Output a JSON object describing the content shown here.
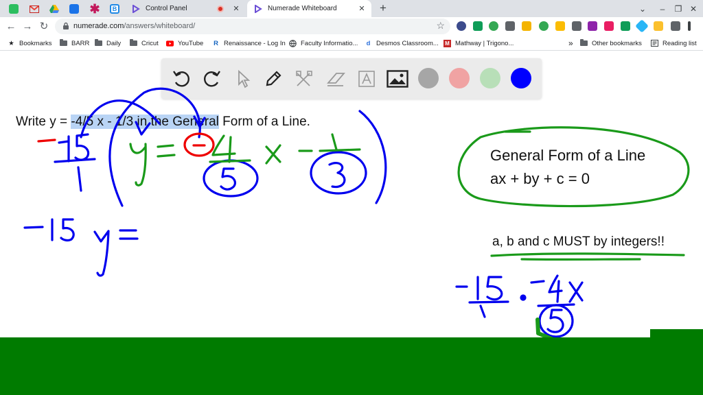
{
  "browser": {
    "pinned_tabs": [
      {
        "icon": "classroom-icon",
        "color": "#2dbe60"
      },
      {
        "icon": "gmail-icon",
        "color": "#ea4335"
      },
      {
        "icon": "drive-icon",
        "color": "#fbbc04"
      },
      {
        "icon": "contacts-icon",
        "color": "#1a73e8"
      },
      {
        "icon": "asterisk-icon",
        "color": "#c2185b"
      },
      {
        "icon": "b-icon",
        "color": "#1e88e5"
      }
    ],
    "tabs": [
      {
        "title": "Control Panel",
        "active": false,
        "icon": "numerade-icon"
      },
      {
        "title": "Numerade Whiteboard",
        "active": true,
        "icon": "numerade-icon"
      }
    ],
    "recording_indicator_color": "#d93025",
    "url_host": "numerade.com",
    "url_path": "/answers/whiteboard/",
    "bookmarks": [
      {
        "label": "Bookmarks",
        "icon": "star-icon"
      },
      {
        "label": "BARR",
        "icon": "folder-icon"
      },
      {
        "label": "Daily",
        "icon": "folder-icon"
      },
      {
        "label": "Cricut",
        "icon": "folder-icon"
      },
      {
        "label": "YouTube",
        "icon": "youtube-icon"
      },
      {
        "label": "Renaissance - Log In",
        "icon": "renaissance-icon"
      },
      {
        "label": "Faculty Informatio...",
        "icon": "globe-icon"
      },
      {
        "label": "Desmos Classroom...",
        "icon": "desmos-icon"
      },
      {
        "label": "Mathway | Trigono...",
        "icon": "mathway-icon"
      }
    ],
    "bookmarks_overflow": "»",
    "other_bookmarks": "Other bookmarks",
    "reading_list": "Reading list"
  },
  "whiteboard": {
    "tools": [
      "undo-icon",
      "redo-icon",
      "pointer-icon",
      "pen-icon",
      "shapes-icon",
      "eraser-icon",
      "text-icon",
      "image-icon"
    ],
    "colors": [
      "#a6a6a6",
      "#f0a3a3",
      "#b8dfb8",
      "#0000ff"
    ],
    "question_pre": "Write y = ",
    "question_hl": "-4/5 x - 1/3 in the General",
    "question_post": " Form of a Line.",
    "general_form_title": "General Form of a Line",
    "general_form_eq": "ax + by + c = 0",
    "integers_note": "a, b and c MUST by integers!!"
  },
  "colors": {
    "ink_blue": "#0000ee",
    "ink_green": "#1a9a1a",
    "ink_red": "#ee0000",
    "bottom_bar": "#007b00"
  }
}
